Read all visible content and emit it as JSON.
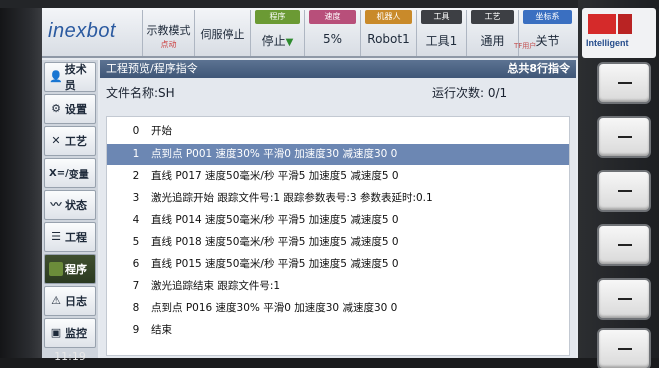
{
  "toolbar": {
    "logo": "inexbot",
    "teach_mode": "示教模式",
    "teach_sub": "点动",
    "servo": "伺服停止",
    "program": {
      "head": "程序",
      "value": "停止"
    },
    "speed": {
      "head": "速度",
      "value": "5%"
    },
    "robot": {
      "head": "机器人",
      "value": "Robot1"
    },
    "tool": {
      "head": "工具",
      "value": "工具1"
    },
    "craft": {
      "head": "工艺",
      "value": "通用"
    },
    "coord": {
      "head": "坐标系",
      "value": "关节"
    },
    "user_badge": "TF用户"
  },
  "sidebar": {
    "items": [
      {
        "label": "技术员",
        "icon": "user-icon"
      },
      {
        "label": "设置",
        "icon": "gear-icon"
      },
      {
        "label": "工艺",
        "icon": "tools-icon"
      },
      {
        "label": "变量",
        "icon": "variable-icon",
        "prefix": "X=/"
      },
      {
        "label": "状态",
        "icon": "status-icon"
      },
      {
        "label": "工程",
        "icon": "list-icon"
      },
      {
        "label": "程序",
        "icon": "program-icon"
      },
      {
        "label": "日志",
        "icon": "warning-icon"
      },
      {
        "label": "监控",
        "icon": "monitor-icon"
      }
    ],
    "time": "11:19"
  },
  "panel": {
    "title": "工程预览/程序指令",
    "total": "总共8行指令",
    "file_label": "文件名称:SH",
    "run_count": "运行次数:  0/1",
    "rows": [
      {
        "no": "0",
        "text": "开始"
      },
      {
        "no": "1",
        "text": "点到点 P001 速度30% 平滑0 加速度30 减速度30 0"
      },
      {
        "no": "2",
        "text": "直线 P017 速度50毫米/秒 平滑5 加速度5 减速度5 0"
      },
      {
        "no": "3",
        "text": "激光追踪开始 跟踪文件号:1 跟踪参数表号:3 参数表延时:0.1"
      },
      {
        "no": "4",
        "text": "直线 P014 速度50毫米/秒 平滑5 加速度5 减速度5 0"
      },
      {
        "no": "5",
        "text": "直线 P018 速度50毫米/秒 平滑5 加速度5 减速度5 0"
      },
      {
        "no": "6",
        "text": "直线 P015 速度50毫米/秒 平滑5 加速度5 减速度5 0"
      },
      {
        "no": "7",
        "text": "激光追踪结束 跟踪文件号:1"
      },
      {
        "no": "8",
        "text": "点到点 P016 速度30% 平滑0 加速度30 减速度30 0"
      },
      {
        "no": "9",
        "text": "结束"
      }
    ],
    "selected_index": 1
  },
  "brand": {
    "text": "Intelligent"
  },
  "colors": {
    "panel_title": "#3f5677",
    "selected_row": "#6c87b3",
    "active_menu": "#2b3a20",
    "logo": "#2b5aa0"
  }
}
